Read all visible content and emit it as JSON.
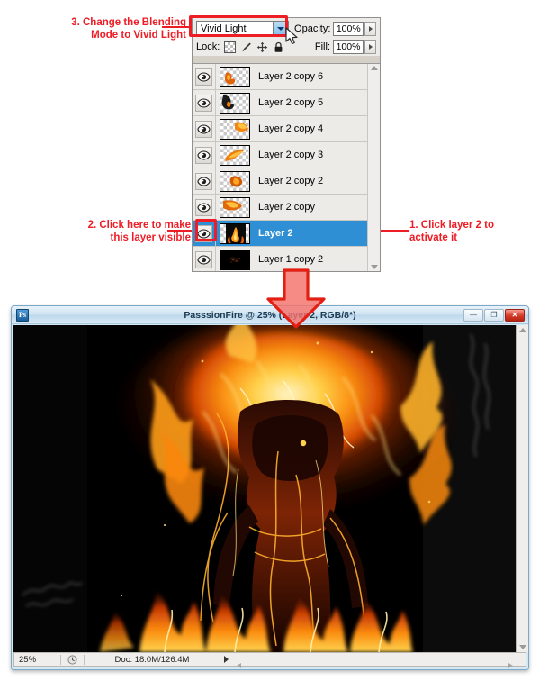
{
  "annotations": [
    {
      "id": "step3",
      "text": "3. Change the Blending\nMode to Vivid Light"
    },
    {
      "id": "step2",
      "text": "2. Click here to make\nthis layer visible"
    },
    {
      "id": "step1",
      "text": "1. Click layer 2 to\nactivate it"
    }
  ],
  "layers_panel": {
    "blend_mode": "Vivid Light",
    "opacity_label": "Opacity:",
    "opacity_value": "100%",
    "lock_label": "Lock:",
    "lock_icons": [
      "transparency-lock-icon",
      "paintbrush-lock-icon",
      "move-lock-icon",
      "lock-all-icon"
    ],
    "fill_label": "Fill:",
    "fill_value": "100%",
    "layers": [
      {
        "name": "Layer 2 copy 6",
        "visible": true,
        "active": false,
        "thumb": "flame-small-left"
      },
      {
        "name": "Layer 2 copy 5",
        "visible": true,
        "active": false,
        "thumb": "flame-dark-topleft"
      },
      {
        "name": "Layer 2 copy 4",
        "visible": true,
        "active": false,
        "thumb": "flame-orange-topright"
      },
      {
        "name": "Layer 2 copy 3",
        "visible": true,
        "active": false,
        "thumb": "flame-streak-diagonal"
      },
      {
        "name": "Layer 2 copy 2",
        "visible": true,
        "active": false,
        "thumb": "flame-blob-center"
      },
      {
        "name": "Layer 2 copy",
        "visible": true,
        "active": false,
        "thumb": "flame-wide-topleft"
      },
      {
        "name": "Layer 2",
        "visible": true,
        "active": true,
        "thumb": "fire-figure-masked"
      },
      {
        "name": "Layer 1 copy 2",
        "visible": true,
        "active": false,
        "thumb": "dark-sparks"
      }
    ]
  },
  "document_window": {
    "title": "PasssionFire @ 25% (Layer 2, RGB/8*)",
    "doc_icon": "photoshop-document-icon",
    "window_buttons": [
      {
        "name": "minimize-button",
        "glyph": "—"
      },
      {
        "name": "maximize-button",
        "glyph": "❐"
      },
      {
        "name": "close-button",
        "glyph": "✕"
      }
    ],
    "status_bar": {
      "zoom": "25%",
      "clock_icon": "clock-icon",
      "doc_info": "Doc: 18.0M/126.4M"
    }
  },
  "colors": {
    "annotation_red": "#ee1c24",
    "active_layer_blue": "#2f8fd4",
    "panel_grey": "#ecebe8",
    "titlebar_blue": "#cfe3f2"
  }
}
